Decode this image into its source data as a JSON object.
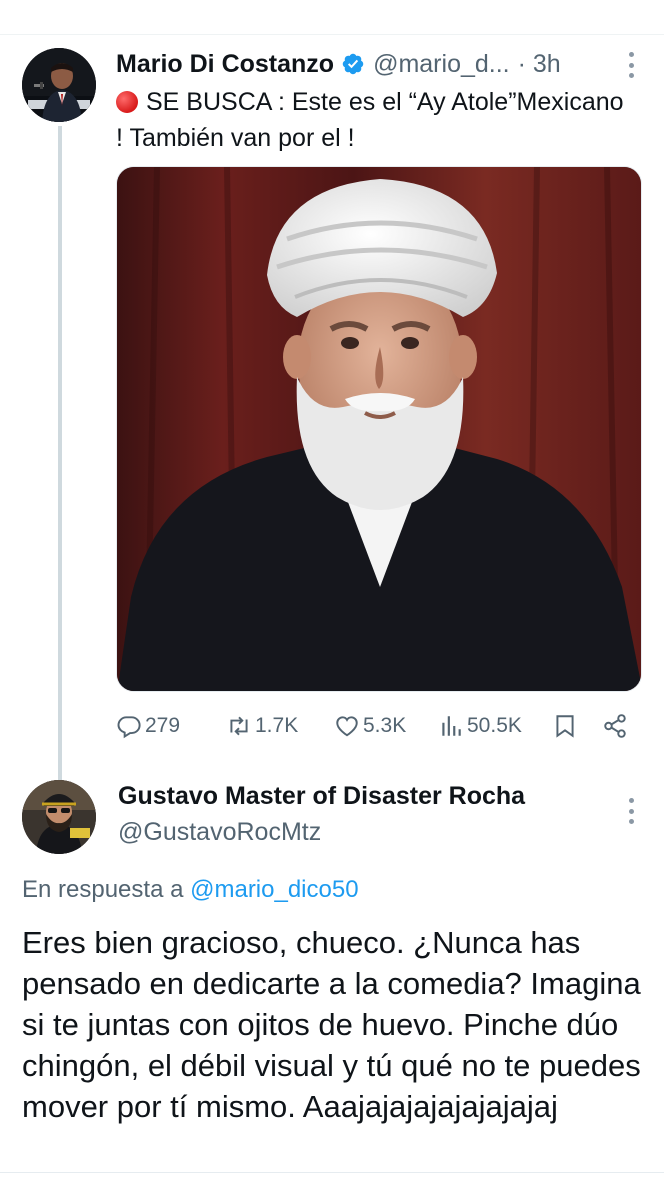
{
  "tweet": {
    "author_name": "Mario Di Costanzo",
    "author_handle": "@mario_d...",
    "time": "· 3h",
    "verified": true,
    "text": "SE BUSCA : Este es el “Ay Atole”Mexicano ! También van por el !",
    "emoji": "red-circle",
    "stats": {
      "replies": "279",
      "reposts": "1.7K",
      "likes": "5.3K",
      "views": "50.5K"
    }
  },
  "reply": {
    "author_name": "Gustavo Master of Disaster Rocha",
    "author_handle": "@GustavoRocMtz",
    "replying_prefix": "En respuesta a",
    "replying_to": "@mario_dico50",
    "text": "Eres bien gracioso, chueco. ¿Nunca has pensado en dedicarte a la comedia? Imagina si te juntas con ojitos de huevo. Pinche dúo chingón, el débil visual y tú qué no te puedes mover por tí mismo. Aaajajajajajajajajaj"
  },
  "colors": {
    "accent": "#1d9bf0",
    "muted": "#536471",
    "text": "#0f1419"
  }
}
